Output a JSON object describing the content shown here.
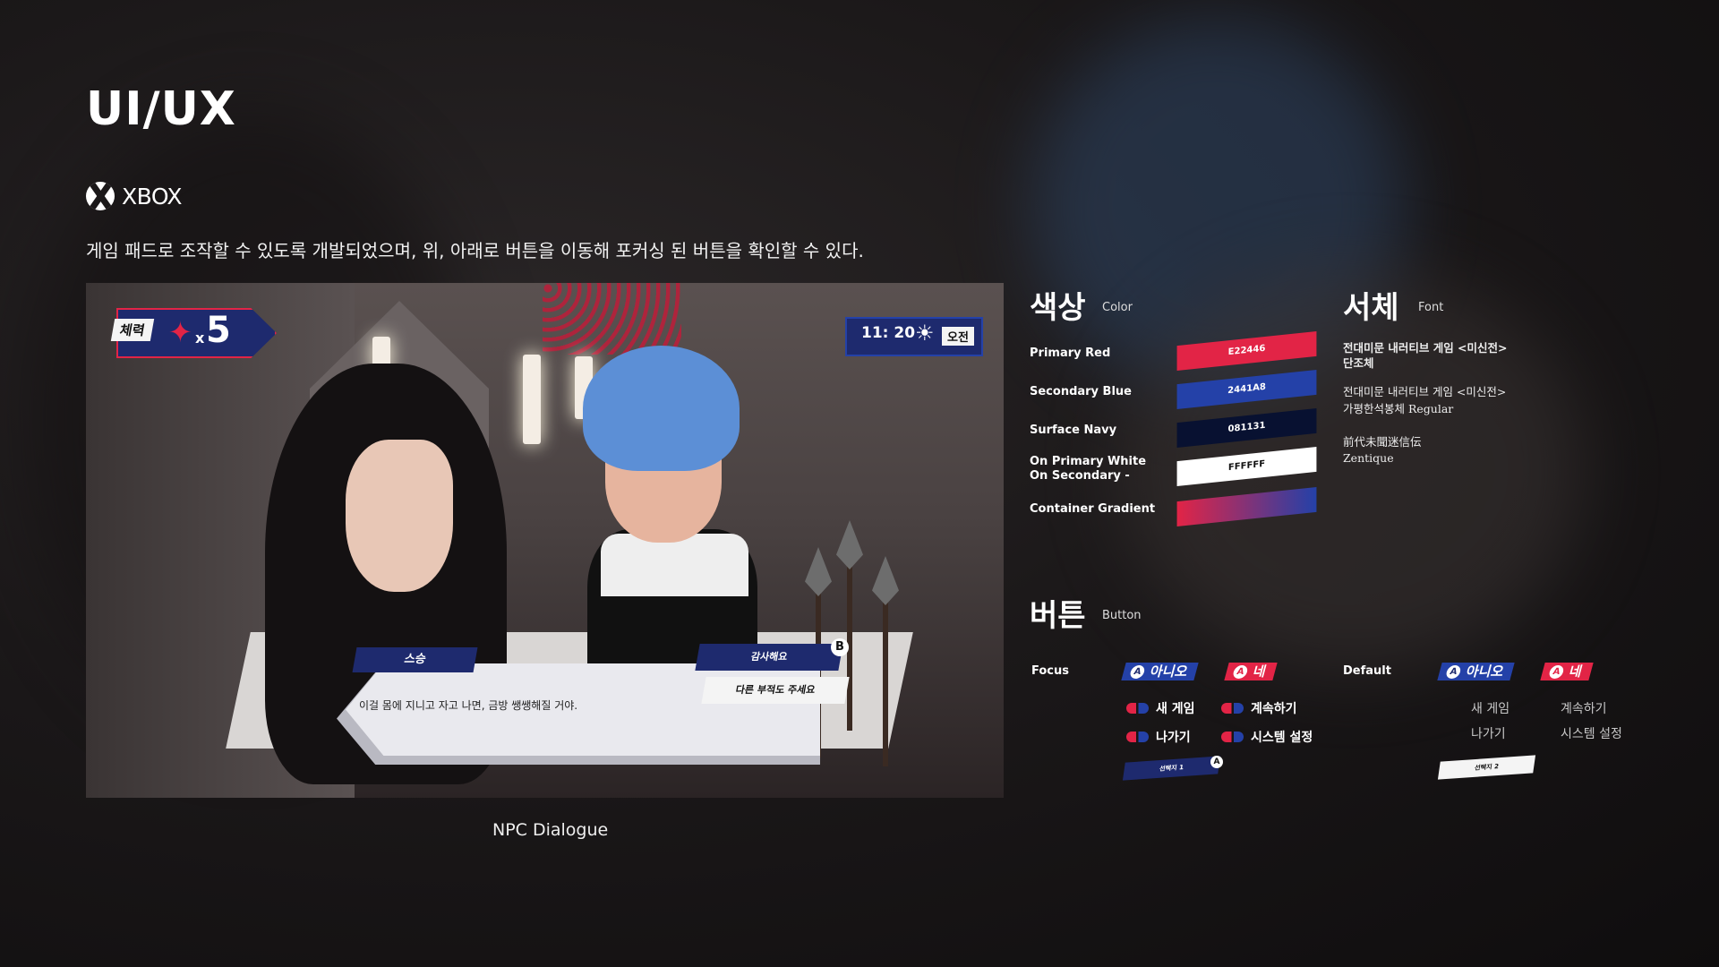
{
  "page": {
    "title": "UI/UX",
    "platform": "XBOX",
    "description": "게임 패드로 조작할 수 있도록 개발되었으며, 위, 아래로 버튼을 이동해 포커싱 된 버튼을 확인할 수 있다.",
    "caption": "NPC Dialogue"
  },
  "hud": {
    "hp_label": "체력",
    "hp_multiplier": "x",
    "hp_count": "5",
    "time": "11: 20",
    "sun_icon": "☀",
    "period": "오전"
  },
  "dialogue": {
    "speaker": "스승",
    "text": "이걸 몸에 지니고 자고 나면, 금방 쌩쌩해질 거야.",
    "option1": "감사해요",
    "option1_key": "B",
    "option2": "다른 부적도 주세요"
  },
  "colors": {
    "title": "색상",
    "subtitle": "Color",
    "items": [
      {
        "label": "Primary Red",
        "hex": "E22446",
        "color": "#e22446"
      },
      {
        "label": "Secondary Blue",
        "hex": "2441A8",
        "color": "#2441a8"
      },
      {
        "label": "Surface Navy",
        "hex": "081131",
        "color": "#081131"
      },
      {
        "label": "On Primary White",
        "label2": "On Secondary -",
        "hex": "FFFFFF",
        "color": "#ffffff"
      },
      {
        "label": "Container Gradient",
        "hex": "",
        "color": "gradient"
      }
    ]
  },
  "fonts": {
    "title": "서체",
    "subtitle": "Font",
    "f1a": "전대미문 내러티브 게임 <미신전>",
    "f1b": "단조체",
    "f2a": "전대미문 내러티브 게임 <미신전>",
    "f2b": "가평한석봉체 Regular",
    "f3a": "前代未聞迷信伝",
    "f3b": "Zentique"
  },
  "buttons": {
    "title": "버튼",
    "subtitle": "Button",
    "focus_label": "Focus",
    "default_label": "Default",
    "key_a": "A",
    "no": "아니오",
    "yes": "네",
    "new_game": "새 게임",
    "continue": "계속하기",
    "exit": "나가기",
    "system_settings": "시스템 설정",
    "choice1": "선택지 1",
    "choice2": "선택지 2"
  }
}
